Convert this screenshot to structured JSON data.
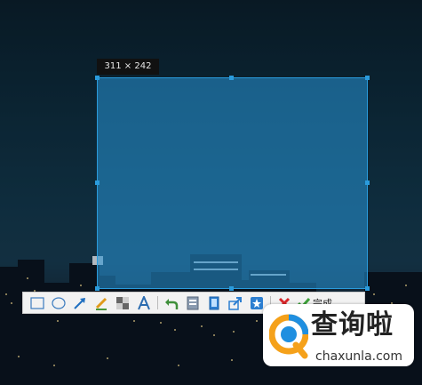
{
  "selection": {
    "size_label": "311 × 242"
  },
  "toolbar": {
    "tools": [
      {
        "icon": "rectangle-icon"
      },
      {
        "icon": "ellipse-icon"
      },
      {
        "icon": "arrow-icon"
      },
      {
        "icon": "pencil-icon"
      },
      {
        "icon": "mosaic-icon"
      },
      {
        "icon": "text-icon"
      },
      {
        "icon": "undo-icon"
      },
      {
        "icon": "save-icon"
      },
      {
        "icon": "copy-icon"
      },
      {
        "icon": "share-icon"
      },
      {
        "icon": "pin-icon"
      },
      {
        "icon": "cancel-icon"
      }
    ],
    "done_label": "完成"
  },
  "watermark": {
    "title": "查询啦",
    "url": "chaxunla.com"
  },
  "colors": {
    "selection_border": "#2a9bdc",
    "selection_fill": "#2896d7",
    "toolbar_bg": "#f2f2f2",
    "watermark_orange": "#f5a11a",
    "watermark_blue": "#1f8fe0"
  }
}
